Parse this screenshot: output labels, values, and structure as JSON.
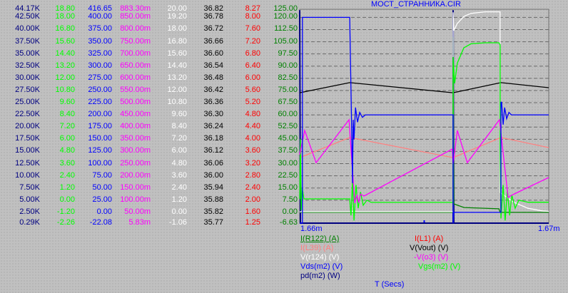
{
  "title": "МОСТ_СТРАННИКА.CIR",
  "x_axis": {
    "label": "T (Secs)",
    "min_label": "1.66m",
    "max_label": "1.67m",
    "range_ms": [
      1.66,
      1.67
    ],
    "mid_tick_ms": 1.665
  },
  "grid": true,
  "axes": [
    {
      "id": "pd",
      "color": "#000080",
      "range": [
        290,
        44170
      ],
      "labels": [
        "44.17K",
        "42.50K",
        "40.00K",
        "37.50K",
        "35.00K",
        "32.50K",
        "30.00K",
        "27.50K",
        "25.00K",
        "22.50K",
        "20.00K",
        "17.50K",
        "15.00K",
        "12.50K",
        "10.00K",
        "7.50K",
        "5.00K",
        "2.50K",
        "0.29K"
      ]
    },
    {
      "id": "vgs",
      "color": "#00ff00",
      "range": [
        -2.26,
        18.8
      ],
      "labels": [
        "18.80",
        "18.00",
        "16.80",
        "15.60",
        "14.40",
        "13.20",
        "12.00",
        "10.80",
        "9.60",
        "8.40",
        "7.20",
        "6.00",
        "4.80",
        "3.60",
        "2.40",
        "1.20",
        "0.00",
        "-1.20",
        "-2.26"
      ]
    },
    {
      "id": "vds",
      "color": "#0000ff",
      "range": [
        -22.08,
        416.65
      ],
      "labels": [
        "416.65",
        "400.00",
        "375.00",
        "350.00",
        "325.00",
        "300.00",
        "275.00",
        "250.00",
        "225.00",
        "200.00",
        "175.00",
        "150.00",
        "125.00",
        "100.00",
        "75.00",
        "50.00",
        "25.00",
        "0.00",
        "-22.08"
      ]
    },
    {
      "id": "vo3",
      "color": "#ff00ff",
      "range": [
        0.00583,
        0.8833
      ],
      "labels": [
        "883.30m",
        "850.00m",
        "800.00m",
        "750.00m",
        "700.00m",
        "650.00m",
        "600.00m",
        "550.00m",
        "500.00m",
        "450.00m",
        "400.00m",
        "350.00m",
        "300.00m",
        "250.00m",
        "200.00m",
        "150.00m",
        "100.00m",
        "50.00m",
        "5.83m"
      ]
    },
    {
      "id": "vr124",
      "color": "#ffffff",
      "range": [
        -1.06,
        20.0
      ],
      "labels": [
        "20.00",
        "19.20",
        "18.00",
        "16.80",
        "15.60",
        "14.40",
        "13.20",
        "12.00",
        "10.80",
        "9.60",
        "8.40",
        "7.20",
        "6.00",
        "4.80",
        "3.60",
        "2.40",
        "1.20",
        "0.00",
        "-1.06"
      ]
    },
    {
      "id": "vout",
      "color": "#000000",
      "range": [
        35.77,
        36.82
      ],
      "labels": [
        "36.82",
        "36.78",
        "36.72",
        "36.66",
        "36.60",
        "36.54",
        "36.48",
        "36.42",
        "36.36",
        "36.30",
        "36.24",
        "36.18",
        "36.12",
        "36.06",
        "36.00",
        "35.94",
        "35.88",
        "35.82",
        "35.77"
      ]
    },
    {
      "id": "il1",
      "color": "#ff0000",
      "range": [
        1.25,
        8.27
      ],
      "labels": [
        "8.27",
        "8.00",
        "7.60",
        "7.20",
        "6.80",
        "6.40",
        "6.00",
        "5.60",
        "5.20",
        "4.80",
        "4.40",
        "4.00",
        "3.60",
        "3.20",
        "2.80",
        "2.40",
        "2.00",
        "1.60",
        "1.25"
      ]
    },
    {
      "id": "ir122",
      "color": "#008000",
      "range": [
        -6.63,
        125.0
      ],
      "labels": [
        "125.00",
        "120.00",
        "112.50",
        "105.00",
        "97.50",
        "90.00",
        "82.50",
        "75.00",
        "67.50",
        "60.00",
        "52.50",
        "45.00",
        "37.50",
        "30.00",
        "22.50",
        "15.00",
        "7.50",
        "0.00",
        "-6.63"
      ]
    }
  ],
  "legend": [
    {
      "label": "I(R122) (A)",
      "color": "#008000",
      "selected": true
    },
    {
      "label": "I(L1) (A)",
      "color": "#ff0000"
    },
    {
      "label": "I(L39) (A)",
      "color": "#ff8080"
    },
    {
      "label": "V(Vout) (V)",
      "color": "#000000"
    },
    {
      "label": "V(r124) (V)",
      "color": "#ffffff"
    },
    {
      "label": "-V(o3) (V)",
      "color": "#ff00ff"
    },
    {
      "label": "Vds(m2) (V)",
      "color": "#0000ff"
    },
    {
      "label": "Vgs(m2) (V)",
      "color": "#00ff00"
    },
    {
      "label": "pd(m2) (W)",
      "color": "#000080"
    }
  ],
  "chart_data": {
    "type": "line",
    "title": "МОСТ_СТРАННИКА.CIR",
    "xlabel": "T (Secs)",
    "xlim_ms": [
      1.66,
      1.67
    ],
    "series": [
      {
        "name": "pd(m2) (W)",
        "axis": "pd",
        "color": "#000080",
        "points": [
          [
            1.66,
            44000
          ],
          [
            1.66003,
            290
          ],
          [
            1.66616,
            290
          ],
          [
            1.66616,
            44000
          ],
          [
            1.66619,
            290
          ],
          [
            1.67,
            290
          ]
        ]
      },
      {
        "name": "I(L39) (A)",
        "axis": "il1",
        "color": "#ff8080",
        "points": [
          [
            1.66,
            3.4
          ],
          [
            1.66201,
            4.06
          ],
          [
            1.66616,
            3.4
          ],
          [
            1.66808,
            4.06
          ],
          [
            1.67,
            3.73
          ]
        ]
      },
      {
        "name": "V(Vout) (V)",
        "axis": "vout",
        "color": "#000000",
        "points": [
          [
            1.66,
            36.41
          ],
          [
            1.66201,
            36.46
          ],
          [
            1.66616,
            36.41
          ],
          [
            1.66808,
            36.46
          ],
          [
            1.67,
            36.435
          ]
        ]
      },
      {
        "name": "I(R122) (A)",
        "axis": "ir122",
        "color": "#008000",
        "points": [
          [
            1.66,
            0
          ],
          [
            1.66616,
            0
          ],
          [
            1.66616,
            108
          ],
          [
            1.66619,
            5.2
          ],
          [
            1.6666,
            3
          ],
          [
            1.668,
            2.2
          ],
          [
            1.66805,
            0
          ],
          [
            1.67,
            0
          ]
        ]
      },
      {
        "name": "V(r124) (V)",
        "axis": "vr124",
        "color": "#ffffff",
        "points": [
          [
            1.66,
            0.06
          ],
          [
            1.66616,
            0.06
          ],
          [
            1.66616,
            19.7
          ],
          [
            1.66619,
            17.9
          ],
          [
            1.66633,
            18.6
          ],
          [
            1.66659,
            19.3
          ],
          [
            1.66688,
            19.6
          ],
          [
            1.66745,
            19.75
          ],
          [
            1.66805,
            19.75
          ],
          [
            1.66805,
            1.95
          ],
          [
            1.6686,
            1.0
          ],
          [
            1.66917,
            0.4
          ],
          [
            1.66974,
            0.15
          ],
          [
            1.67,
            0.1
          ]
        ]
      },
      {
        "name": "Vgs(m2) (V)",
        "axis": "vgs",
        "color": "#00ff00",
        "points": [
          [
            1.66,
            0.1
          ],
          [
            1.66003,
            6
          ],
          [
            1.66006,
            -1
          ],
          [
            1.6601,
            1.2
          ],
          [
            1.66017,
            0.125
          ],
          [
            1.66201,
            0.125
          ],
          [
            1.66206,
            -1.5
          ],
          [
            1.66212,
            2
          ],
          [
            1.66218,
            -2
          ],
          [
            1.66226,
            1.5
          ],
          [
            1.66235,
            -0.8
          ],
          [
            1.66244,
            0.8
          ],
          [
            1.66255,
            -0.5
          ],
          [
            1.6627,
            0
          ],
          [
            1.66287,
            -0.22
          ],
          [
            1.66616,
            -0.22
          ],
          [
            1.66616,
            14.1
          ],
          [
            1.66622,
            11.5
          ],
          [
            1.66633,
            13.5
          ],
          [
            1.66659,
            15
          ],
          [
            1.66688,
            15.4
          ],
          [
            1.66745,
            15.5
          ],
          [
            1.668,
            15.5
          ],
          [
            1.66805,
            15.3
          ],
          [
            1.66805,
            5
          ],
          [
            1.66808,
            -1.8
          ],
          [
            1.66817,
            1.5
          ],
          [
            1.66825,
            -2
          ],
          [
            1.66834,
            1
          ],
          [
            1.66843,
            -1.5
          ],
          [
            1.66852,
            0.5
          ],
          [
            1.66865,
            -0.8
          ],
          [
            1.6688,
            0
          ],
          [
            1.66917,
            -0.2
          ],
          [
            1.67,
            -0.2
          ]
        ]
      },
      {
        "name": "-V(o3) (V)",
        "axis": "vo3",
        "color": "#ff00ff",
        "points": [
          [
            1.66,
            0.287
          ],
          [
            1.6602,
            0.386
          ],
          [
            1.66066,
            0.254
          ],
          [
            1.66198,
            0.43
          ],
          [
            1.66221,
            0.088
          ],
          [
            1.6623,
            0.12
          ],
          [
            1.66237,
            0.09
          ],
          [
            1.66244,
            0.125
          ],
          [
            1.66258,
            0.117
          ],
          [
            1.66613,
            0.31
          ],
          [
            1.66616,
            0.249
          ],
          [
            1.66633,
            0.386
          ],
          [
            1.66673,
            0.254
          ],
          [
            1.66802,
            0.43
          ],
          [
            1.66837,
            0.111
          ],
          [
            1.6685,
            0.12
          ],
          [
            1.67,
            0.193
          ]
        ]
      },
      {
        "name": "Vds(m2) (V)",
        "axis": "vds",
        "color": "#0000ff",
        "points": [
          [
            1.66,
            -22
          ],
          [
            1.66011,
            -22
          ],
          [
            1.66011,
            400
          ],
          [
            1.66201,
            400
          ],
          [
            1.66206,
            250
          ],
          [
            1.66212,
            60
          ],
          [
            1.66215,
            190
          ],
          [
            1.66218,
            150
          ],
          [
            1.66224,
            215
          ],
          [
            1.66232,
            185
          ],
          [
            1.66241,
            205
          ],
          [
            1.66252,
            195
          ],
          [
            1.66264,
            200
          ],
          [
            1.66616,
            200
          ],
          [
            1.66616,
            -22
          ],
          [
            1.66619,
            0
          ],
          [
            1.66808,
            0
          ],
          [
            1.66808,
            226
          ],
          [
            1.66811,
            226
          ],
          [
            1.66817,
            180
          ],
          [
            1.66823,
            215
          ],
          [
            1.66831,
            192
          ],
          [
            1.6684,
            205
          ],
          [
            1.6685,
            200
          ],
          [
            1.67,
            200
          ]
        ]
      }
    ]
  }
}
